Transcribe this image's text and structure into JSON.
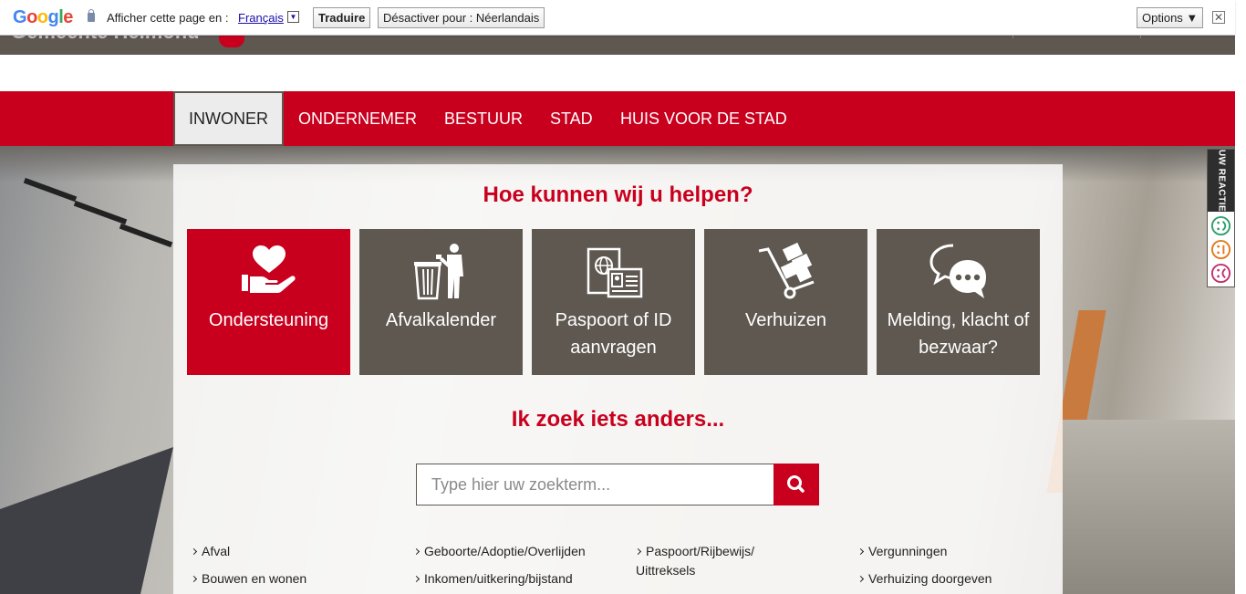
{
  "translate_bar": {
    "google_logo": "Google",
    "prompt": "Afficher cette page en :",
    "language": "Français",
    "translate_button": "Traduire",
    "disable_button": "Désactiver pour : Néerlandais",
    "options_button": "Options ▼",
    "close": "✕"
  },
  "header": {
    "site_name": "Gemeente Helmond"
  },
  "nav": {
    "items": [
      {
        "label": "INWONER",
        "active": true
      },
      {
        "label": "ONDERNEMER"
      },
      {
        "label": "BESTUUR"
      },
      {
        "label": "STAD"
      },
      {
        "label": "HUIS VOOR DE STAD"
      }
    ]
  },
  "main": {
    "help_title": "Hoe kunnen wij u helpen?",
    "tiles": [
      {
        "label": "Ondersteuning",
        "icon": "heart-hand-icon"
      },
      {
        "label": "Afvalkalender",
        "icon": "trash-person-icon"
      },
      {
        "label": "Paspoort of ID aanvragen",
        "icon": "passport-icon"
      },
      {
        "label": "Verhuizen",
        "icon": "moving-cart-icon"
      },
      {
        "label": "Melding, klacht of bezwaar?",
        "icon": "chat-bubbles-icon"
      }
    ],
    "other_title": "Ik zoek iets anders...",
    "search": {
      "placeholder": "Type hier uw zoekterm...",
      "icon": "search-icon"
    },
    "links": [
      [
        "Afval",
        "Bouwen en wonen"
      ],
      [
        "Geboorte/Adoptie/Overlijden",
        "Inkomen/uitkering/bijstand"
      ],
      [
        "Paspoort/Rijbewijs/ Uittreksels"
      ],
      [
        "Vergunningen",
        "Verhuizing doorgeven"
      ]
    ]
  },
  "feedback": {
    "label": "UW REACTIE",
    "options": [
      "positive",
      "neutral",
      "negative"
    ],
    "colors": {
      "positive": "#2e9e6a",
      "neutral": "#e07b1c",
      "negative": "#c2306a"
    }
  },
  "colors": {
    "brand_red": "#c8001e",
    "tile_brown": "#5f5850"
  }
}
